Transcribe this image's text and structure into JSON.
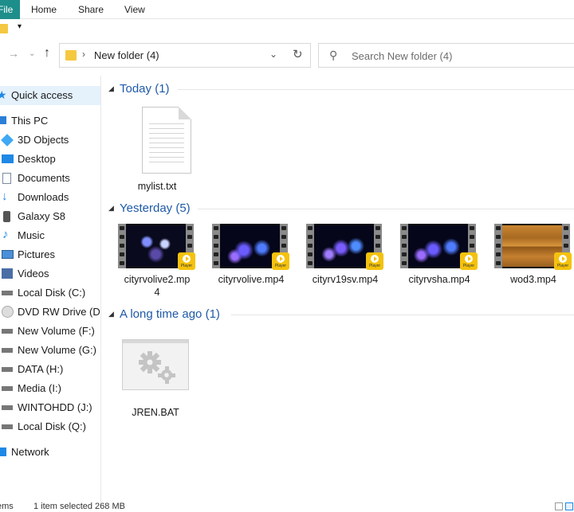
{
  "ribbon": {
    "file_label": "File",
    "tabs": [
      "Home",
      "Share",
      "View"
    ]
  },
  "navigation": {
    "back_icon": "arrow-left-icon",
    "forward_icon": "arrow-right-icon",
    "recent_icon": "chevron-down-icon",
    "up_icon": "arrow-up-icon",
    "address_path": "New folder (4)",
    "search_placeholder": "Search New folder (4)"
  },
  "sidebar": {
    "items": [
      {
        "label": "Quick access",
        "icon": "star-icon",
        "color": "#1e88e5"
      },
      {
        "label": "This PC",
        "icon": "computer-icon",
        "color": "#2b7fd6"
      },
      {
        "label": "3D Objects",
        "icon": "cube-icon",
        "color": "#3fa9f5"
      },
      {
        "label": "Desktop",
        "icon": "desktop-icon",
        "color": "#1e88e5"
      },
      {
        "label": "Documents",
        "icon": "documents-icon",
        "color": "#7a8ca0"
      },
      {
        "label": "Downloads",
        "icon": "download-icon",
        "color": "#1e88e5"
      },
      {
        "label": "Galaxy S8",
        "icon": "phone-icon",
        "color": "#555555"
      },
      {
        "label": "Music",
        "icon": "music-icon",
        "color": "#1e88e5"
      },
      {
        "label": "Pictures",
        "icon": "pictures-icon",
        "color": "#4a90d9"
      },
      {
        "label": "Videos",
        "icon": "videos-icon",
        "color": "#4a6fa5"
      },
      {
        "label": "Local Disk (C:)",
        "icon": "drive-icon",
        "color": "#777777"
      },
      {
        "label": "DVD RW Drive (D:",
        "icon": "dvd-icon",
        "color": "#aaaaaa"
      },
      {
        "label": "New Volume (F:)",
        "icon": "drive-icon",
        "color": "#777777"
      },
      {
        "label": "New Volume (G:)",
        "icon": "drive-icon",
        "color": "#777777"
      },
      {
        "label": "DATA (H:)",
        "icon": "drive-icon",
        "color": "#777777"
      },
      {
        "label": "Media (I:)",
        "icon": "drive-icon",
        "color": "#777777"
      },
      {
        "label": "WINTOHDD (J:)",
        "icon": "drive-icon",
        "color": "#777777"
      },
      {
        "label": "Local Disk (Q:)",
        "icon": "drive-icon",
        "color": "#777777"
      },
      {
        "label": "Network",
        "icon": "network-icon",
        "color": "#1e88e5"
      }
    ]
  },
  "groups": {
    "today": {
      "label": "Today (1)"
    },
    "yesterday": {
      "label": "Yesterday (5)"
    },
    "long_ago": {
      "label": "A long time ago (1)"
    }
  },
  "files": {
    "today": [
      {
        "name": "mylist.txt",
        "icon": "text-file-icon"
      }
    ],
    "yesterday": [
      {
        "name_line1": "cityrvolive2.mp",
        "name_line2": "4",
        "icon": "video-thumbnail"
      },
      {
        "name": "cityrvolive.mp4",
        "icon": "video-thumbnail"
      },
      {
        "name": "cityrv19sv.mp4",
        "icon": "video-thumbnail"
      },
      {
        "name": "cityrvsha.mp4",
        "icon": "video-thumbnail"
      },
      {
        "name": "wod3.mp4",
        "icon": "video-thumbnail"
      }
    ],
    "long_ago": [
      {
        "name": "JREN.BAT",
        "icon": "batch-file-gears-icon"
      }
    ],
    "player_badge_label": "Player"
  },
  "status": {
    "items_count": "ems",
    "selection": "1 item selected  268 MB"
  },
  "colors": {
    "file_tab": "#1e8e8a",
    "group_header": "#1e5aa8",
    "selection": "#e5f1fb",
    "player_badge": "#f4c20d"
  }
}
